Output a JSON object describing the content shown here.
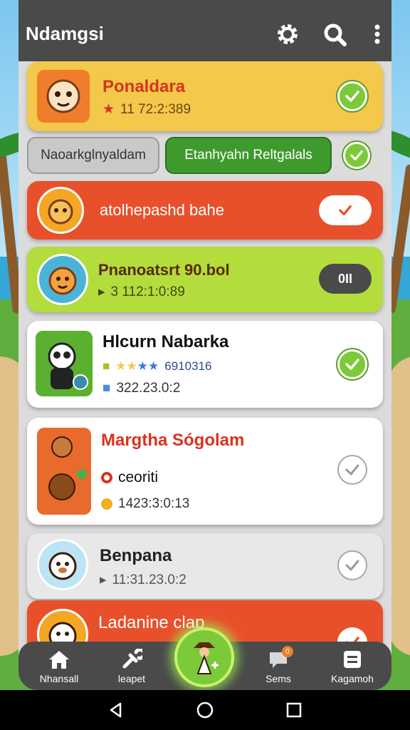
{
  "app": {
    "title": "Ndamgsi"
  },
  "header_icons": [
    "gear-icon",
    "search-icon",
    "more-vertical-icon"
  ],
  "cards": [
    {
      "title": "Ponaldara",
      "meta": "11 72:2:389",
      "meta_icon": "star-icon",
      "status": "checked",
      "color": "#f4c84a"
    },
    {
      "title": "atolhepashd bahe",
      "toggle_state": "on",
      "color": "#e8502c"
    },
    {
      "title": "Pnanoatsrt 90.bol",
      "meta": "3 112:1:0:89",
      "badge": "0II",
      "color": "#b3dc3d"
    },
    {
      "title": "Hlcurn Nabarka",
      "meta_rating": "6910316",
      "meta": "322.23.0:2",
      "status": "checked",
      "color": "#ffffff"
    },
    {
      "title": "Margtha Sógolam",
      "meta_status": "ceoriti",
      "meta": "1423:3:0:13",
      "status": "unchecked",
      "color": "#ffffff"
    },
    {
      "title": "Benpana",
      "meta": "11:31.23.0:2",
      "status": "unchecked",
      "color": "#e8e8e8"
    },
    {
      "title": "Ladanine clap",
      "color": "#e8502c"
    }
  ],
  "filter_pills": [
    {
      "label": "Naoarkglnyaldam",
      "style": "grey"
    },
    {
      "label": "Etanhyahn Reltgalals",
      "style": "green"
    }
  ],
  "bottom_nav": [
    {
      "label": "Nhansall",
      "icon": "home-icon"
    },
    {
      "label": "leapet",
      "icon": "tools-icon"
    },
    {
      "label": "Sems",
      "icon": "chat-icon",
      "badge": "0"
    },
    {
      "label": "Kagamoh",
      "icon": "list-icon"
    }
  ],
  "colors": {
    "accent": "#7cc93a",
    "header": "#4a4a4a",
    "danger": "#e8502c",
    "warning": "#f4c84a"
  }
}
